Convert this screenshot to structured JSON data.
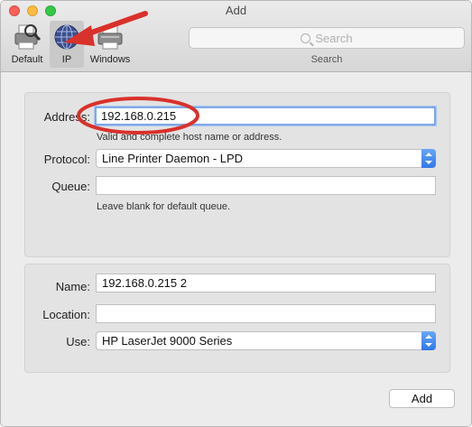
{
  "window": {
    "title": "Add"
  },
  "toolbar": {
    "items": [
      {
        "label": "Default",
        "icon": "default-printer-icon"
      },
      {
        "label": "IP",
        "icon": "ip-globe-icon",
        "selected": true
      },
      {
        "label": "Windows",
        "icon": "windows-printer-icon"
      }
    ],
    "search": {
      "placeholder": "Search",
      "caption": "Search"
    }
  },
  "form": {
    "address": {
      "label": "Address:",
      "value": "192.168.0.215",
      "hint": "Valid and complete host name or address."
    },
    "protocol": {
      "label": "Protocol:",
      "value": "Line Printer Daemon - LPD"
    },
    "queue": {
      "label": "Queue:",
      "value": "",
      "hint": "Leave blank for default queue."
    },
    "name": {
      "label": "Name:",
      "value": "192.168.0.215 2"
    },
    "location": {
      "label": "Location:",
      "value": ""
    },
    "use": {
      "label": "Use:",
      "value": "HP LaserJet 9000 Series"
    }
  },
  "actions": {
    "add_label": "Add"
  },
  "colors": {
    "annotation_red": "#d9312b",
    "accent_blue": "#2f78ea"
  }
}
